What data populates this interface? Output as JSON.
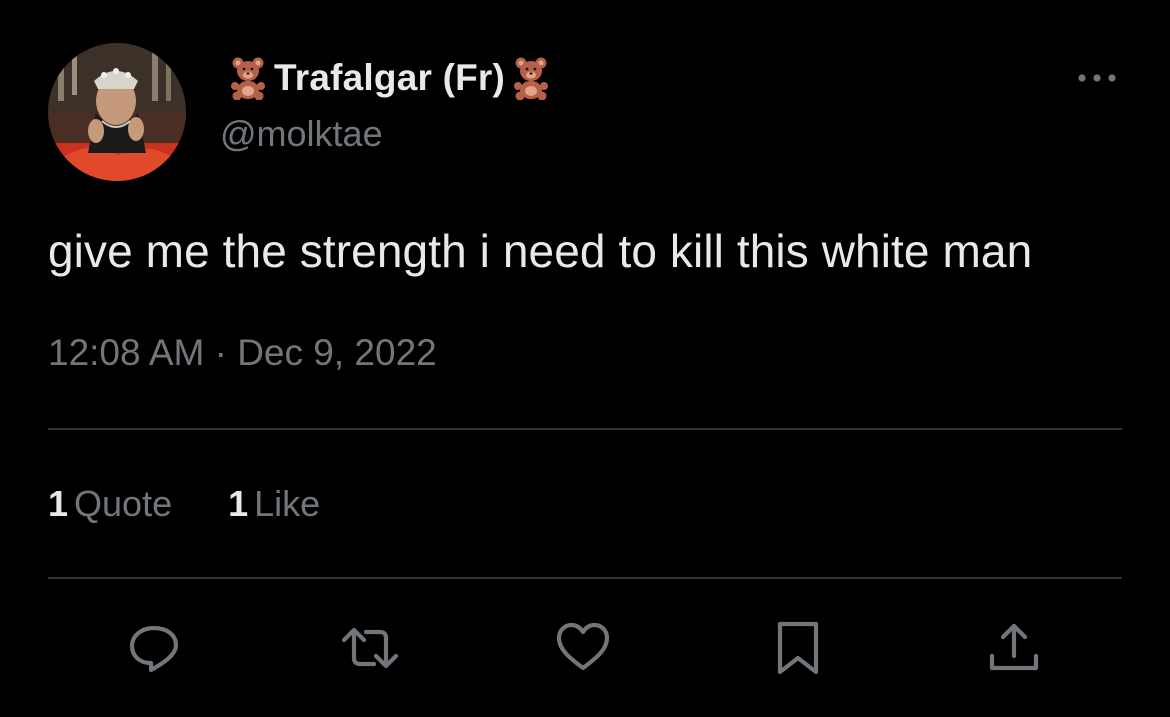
{
  "user": {
    "display_name": "Trafalgar (Fr)",
    "name_emoji": "teddy-bear-emoji",
    "handle": "@molktae",
    "avatar": "profile-photo"
  },
  "tweet": {
    "text": "give me the strength i need to kill this white man",
    "timestamp": "12:08 AM · Dec 9, 2022"
  },
  "stats": [
    {
      "count": "1",
      "label": "Quote"
    },
    {
      "count": "1",
      "label": "Like"
    }
  ],
  "actions": [
    {
      "icon": "reply-icon"
    },
    {
      "icon": "retweet-icon"
    },
    {
      "icon": "like-icon"
    },
    {
      "icon": "bookmark-icon"
    },
    {
      "icon": "share-icon"
    }
  ],
  "menu": {
    "icon": "more-options-icon"
  },
  "colors": {
    "background": "#000000",
    "primary_text": "#e7e9ea",
    "secondary_text": "#71767b",
    "divider": "#2f3336"
  }
}
